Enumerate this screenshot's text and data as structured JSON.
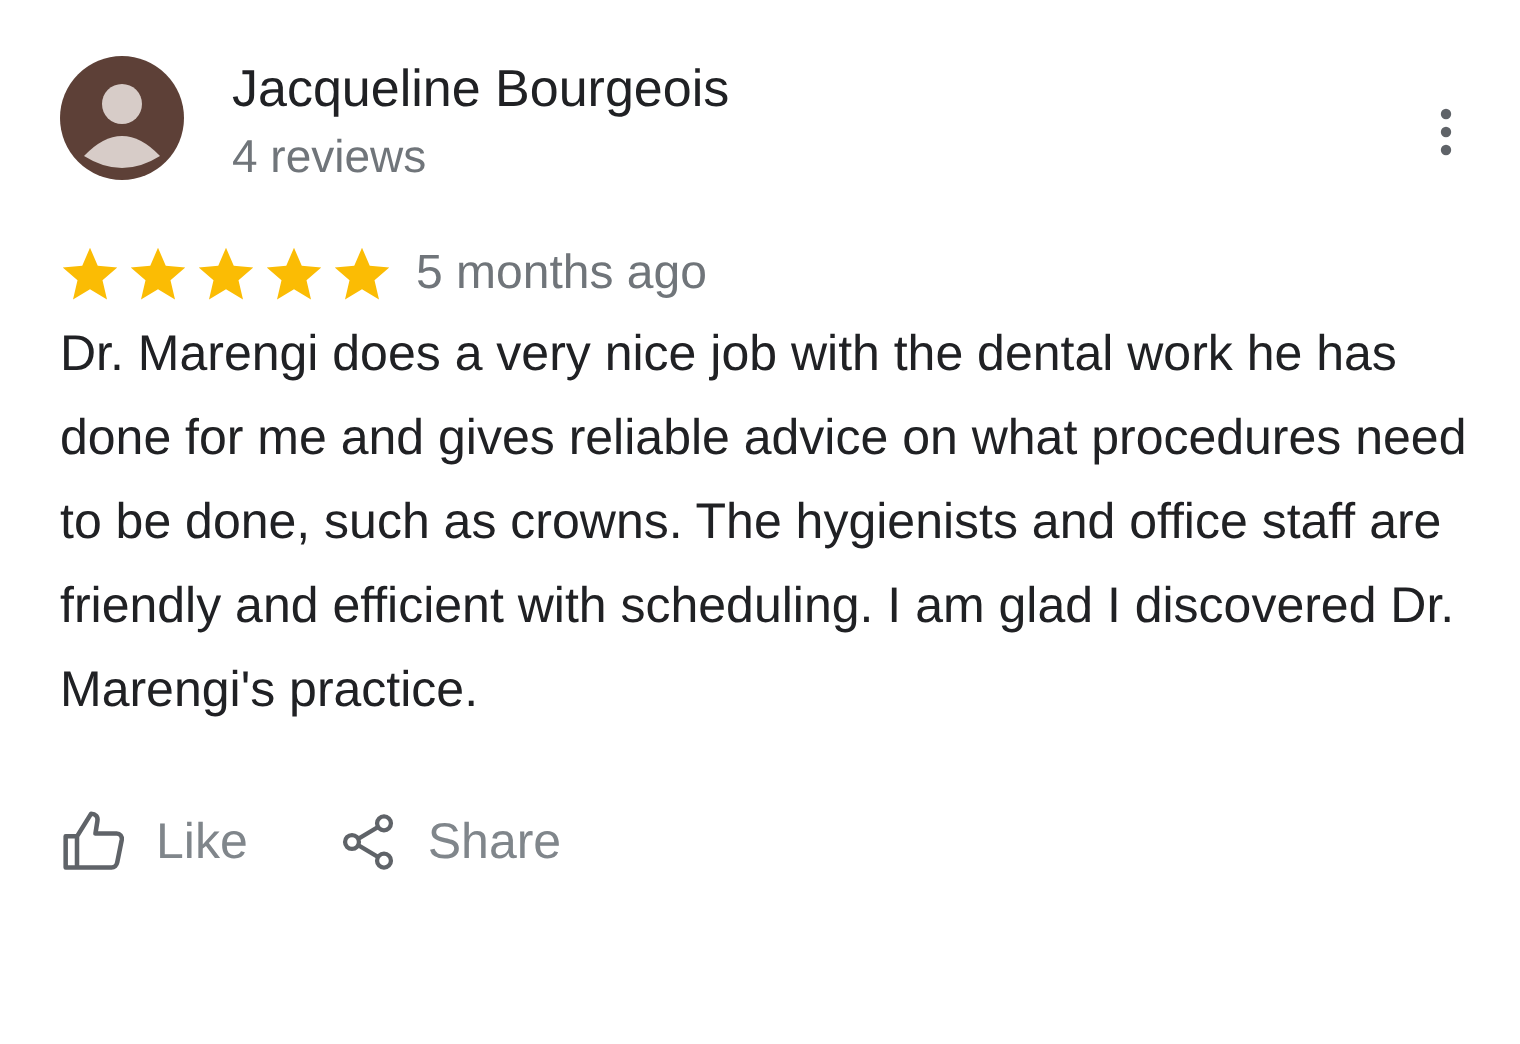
{
  "review": {
    "reviewer": "Jacqueline Bourgeois",
    "review_count": "4 reviews",
    "stars": 5,
    "time": "5 months ago",
    "text": "Dr. Marengi does a very nice job with the dental work he has done for me and gives reliable advice on what procedures need to be done, such as crowns. The hygienists and office staff are friendly and efficient with scheduling. I am glad I discovered Dr. Marengi's practice."
  },
  "actions": [
    {
      "kind": "like",
      "label": "Like"
    },
    {
      "kind": "share",
      "label": "Share"
    }
  ]
}
